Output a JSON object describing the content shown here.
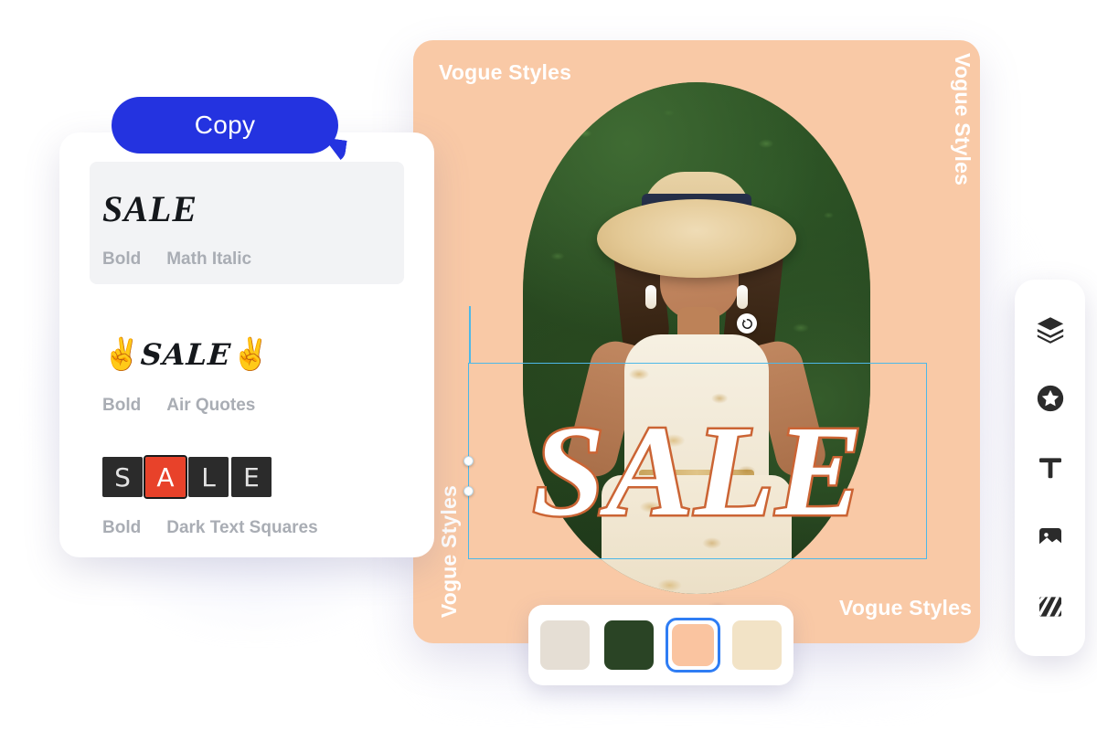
{
  "app": {
    "accent_blue": "#2433e0",
    "selection_blue": "#4db8e8",
    "canvas_bg": "#f9c9a6"
  },
  "copy_tooltip": {
    "label": "Copy"
  },
  "style_panel": {
    "styles": [
      {
        "sample": "SALE",
        "weight_label": "Bold",
        "style_label": "Math Italic",
        "active": true
      },
      {
        "sample": "SALE",
        "emoji_left": "✌",
        "emoji_right": "✌",
        "weight_label": "Bold",
        "style_label": "Air Quotes",
        "active": false
      },
      {
        "letters": [
          "S",
          "A",
          "L",
          "E"
        ],
        "highlight_index": 1,
        "weight_label": "Bold",
        "style_label": "Dark Text Squares",
        "active": false
      }
    ]
  },
  "canvas": {
    "title": "Vogue Styles",
    "title_right": "Vogue Styles",
    "title_left": "Vogue Styles",
    "title_bottom": "Vogue Styles",
    "artwork_text": "SALE",
    "artwork_text_color": "#ffffff",
    "artwork_outline_color": "#cb6434"
  },
  "palette": {
    "swatches": [
      {
        "name": "beige",
        "color": "#e5ded4",
        "selected": false
      },
      {
        "name": "dark-green",
        "color": "#2a4425",
        "selected": false
      },
      {
        "name": "peach",
        "color": "#fac4a0",
        "selected": true
      },
      {
        "name": "cream",
        "color": "#f2e3c6",
        "selected": false
      }
    ]
  },
  "toolbar": {
    "tools": [
      {
        "name": "layers",
        "label": "Layers"
      },
      {
        "name": "elements",
        "label": "Elements"
      },
      {
        "name": "text",
        "label": "Text"
      },
      {
        "name": "image",
        "label": "Image"
      },
      {
        "name": "background",
        "label": "Background"
      }
    ]
  }
}
